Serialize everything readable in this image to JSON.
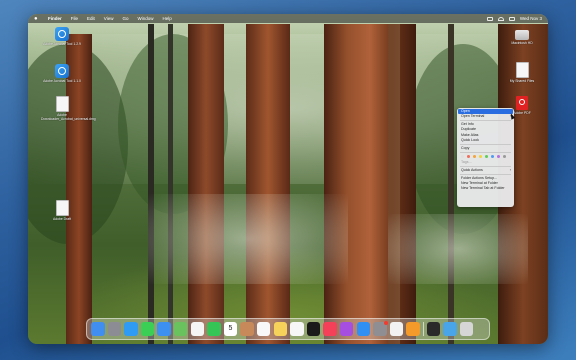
{
  "menubar": {
    "app_name": "Finder",
    "items": [
      "File",
      "Edit",
      "View",
      "Go",
      "Window",
      "Help"
    ],
    "clock": "Wed Nov 3"
  },
  "desktop_icons": [
    {
      "label": "Adobe Acrobat Tool 1.2.9",
      "icon": "app-globe-icon"
    },
    {
      "label": "Adobe Acrobat Tool 1.1.0",
      "icon": "app-globe-icon"
    },
    {
      "label": "Adobe Downloader_Acrobat_universal.dmg",
      "icon": "document-icon"
    },
    {
      "label": "Adobe Draft",
      "icon": "document-icon"
    },
    {
      "label": "Macintosh HD",
      "icon": "disk-icon"
    },
    {
      "label": "My Shared Files",
      "icon": "document-icon"
    },
    {
      "label": "Adobe PDF",
      "icon": "pdf-icon"
    }
  ],
  "context_menu": {
    "items": [
      {
        "label": "Open",
        "selected": true
      },
      {
        "label": "Open Terminal",
        "submenu": true
      },
      {
        "sep": true
      },
      {
        "label": "Get Info"
      },
      {
        "label": "Duplicate"
      },
      {
        "label": "Make Alias"
      },
      {
        "label": "Quick Look"
      },
      {
        "sep": true
      },
      {
        "label": "Copy"
      },
      {
        "sep": true
      },
      {
        "tags": true
      },
      {
        "label": "Tags...",
        "disabled": true
      },
      {
        "sep": true
      },
      {
        "label": "Quick Actions",
        "submenu": true
      },
      {
        "sep": true
      },
      {
        "label": "Folder Actions Setup..."
      },
      {
        "label": "New Terminal at Folder"
      },
      {
        "label": "New Terminal Tab at Folder"
      }
    ],
    "tag_colors": [
      "#e0e0e0",
      "#f26d5b",
      "#f5a33c",
      "#f2d33c",
      "#5fcc5a",
      "#4f9bf2",
      "#b46fe0",
      "#9a9a9a"
    ]
  },
  "dock": {
    "calendar_day": "5",
    "apps": [
      {
        "name": "finder-icon",
        "color": "#3f8ef0"
      },
      {
        "name": "launchpad-icon",
        "color": "#8c8c95"
      },
      {
        "name": "safari-icon",
        "color": "#2f9bf2"
      },
      {
        "name": "messages-icon",
        "color": "#3ccf55"
      },
      {
        "name": "mail-icon",
        "color": "#3d8ff0"
      },
      {
        "name": "maps-icon",
        "color": "#6ac25e"
      },
      {
        "name": "photos-icon",
        "color": "#f5f5f5"
      },
      {
        "name": "facetime-icon",
        "color": "#35c556"
      },
      {
        "name": "calendar-icon",
        "color": "#ffffff"
      },
      {
        "name": "contacts-icon",
        "color": "#c8895a"
      },
      {
        "name": "reminders-icon",
        "color": "#f8f8f8"
      },
      {
        "name": "notes-icon",
        "color": "#f6d25a"
      },
      {
        "name": "freeform-icon",
        "color": "#f7f7f7"
      },
      {
        "name": "apple-tv-icon",
        "color": "#1a1a1a"
      },
      {
        "name": "music-icon",
        "color": "#f5405a"
      },
      {
        "name": "podcasts-icon",
        "color": "#a64ee0"
      },
      {
        "name": "app-store-icon",
        "color": "#2f8ff2"
      },
      {
        "name": "system-settings-icon",
        "color": "#8e8e93"
      },
      {
        "name": "preview-icon",
        "color": "#f2f2f2"
      },
      {
        "name": "pages-icon",
        "color": "#f39a2a"
      },
      {
        "name": "terminal-icon",
        "color": "#2a2a2a"
      },
      {
        "name": "downloads-folder-icon",
        "color": "#4aa5e8"
      },
      {
        "name": "trash-icon",
        "color": "#d6d6d6"
      }
    ]
  }
}
